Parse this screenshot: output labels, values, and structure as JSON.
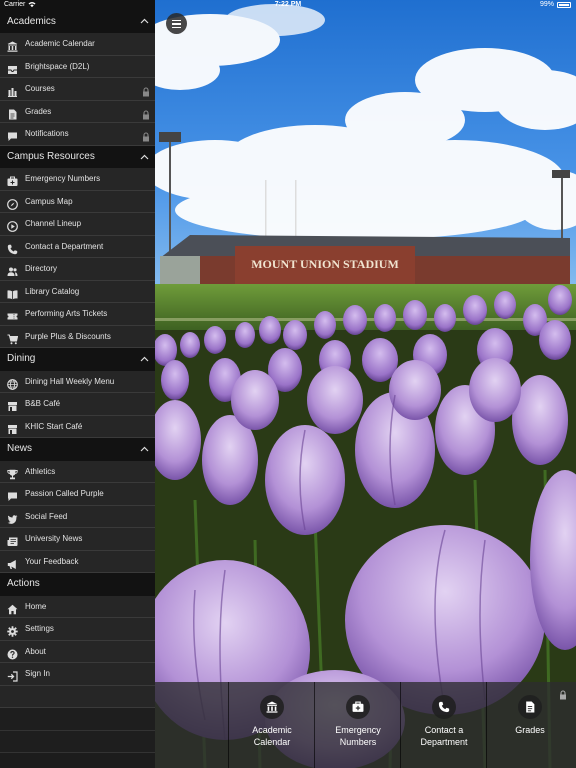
{
  "status_bar": {
    "carrier": "Carrier",
    "time": "7:22 PM",
    "battery": "99%"
  },
  "photo": {
    "sign_text": "MOUNT UNION STADIUM"
  },
  "sidebar": {
    "academics": {
      "title": "Academics",
      "items": [
        {
          "label": "Academic Calendar",
          "icon": "bank-icon",
          "locked": false
        },
        {
          "label": "Brightspace (D2L)",
          "icon": "inbox-icon",
          "locked": false
        },
        {
          "label": "Courses",
          "icon": "bar-chart-icon",
          "locked": true
        },
        {
          "label": "Grades",
          "icon": "document-icon",
          "locked": true
        },
        {
          "label": "Notifications",
          "icon": "chat-bubble-icon",
          "locked": true
        }
      ]
    },
    "campus_resources": {
      "title": "Campus Resources",
      "items": [
        {
          "label": "Emergency Numbers",
          "icon": "medkit-icon"
        },
        {
          "label": "Campus Map",
          "icon": "compass-icon"
        },
        {
          "label": "Channel Lineup",
          "icon": "play-icon"
        },
        {
          "label": "Contact a Department",
          "icon": "phone-icon"
        },
        {
          "label": "Directory",
          "icon": "people-icon"
        },
        {
          "label": "Library Catalog",
          "icon": "book-icon"
        },
        {
          "label": "Performing Arts Tickets",
          "icon": "ticket-icon"
        },
        {
          "label": "Purple Plus & Discounts",
          "icon": "cart-icon"
        }
      ]
    },
    "dining": {
      "title": "Dining",
      "items": [
        {
          "label": "Dining Hall Weekly Menu",
          "icon": "globe-icon"
        },
        {
          "label": "B&B Café",
          "icon": "store-icon"
        },
        {
          "label": "KHIC Start Café",
          "icon": "store-icon"
        }
      ]
    },
    "news": {
      "title": "News",
      "items": [
        {
          "label": "Athletics",
          "icon": "trophy-icon"
        },
        {
          "label": "Passion Called Purple",
          "icon": "chat-bubble-icon"
        },
        {
          "label": "Social Feed",
          "icon": "bird-icon"
        },
        {
          "label": "University News",
          "icon": "newspaper-icon"
        },
        {
          "label": "Your Feedback",
          "icon": "megaphone-icon"
        }
      ]
    },
    "actions": {
      "title": "Actions",
      "items": [
        {
          "label": "Home",
          "icon": "home-icon"
        },
        {
          "label": "Settings",
          "icon": "gear-icon"
        },
        {
          "label": "About",
          "icon": "question-icon"
        },
        {
          "label": "Sign In",
          "icon": "sign-in-icon"
        }
      ]
    }
  },
  "quick_links": [
    {
      "line1": "Academic",
      "line2": "Calendar",
      "icon": "bank-icon",
      "locked": false
    },
    {
      "line1": "Emergency",
      "line2": "Numbers",
      "icon": "medkit-icon",
      "locked": false
    },
    {
      "line1": "Contact a",
      "line2": "Department",
      "icon": "phone-icon",
      "locked": false
    },
    {
      "line1": "Grades",
      "line2": "",
      "icon": "document-icon",
      "locked": true
    }
  ]
}
